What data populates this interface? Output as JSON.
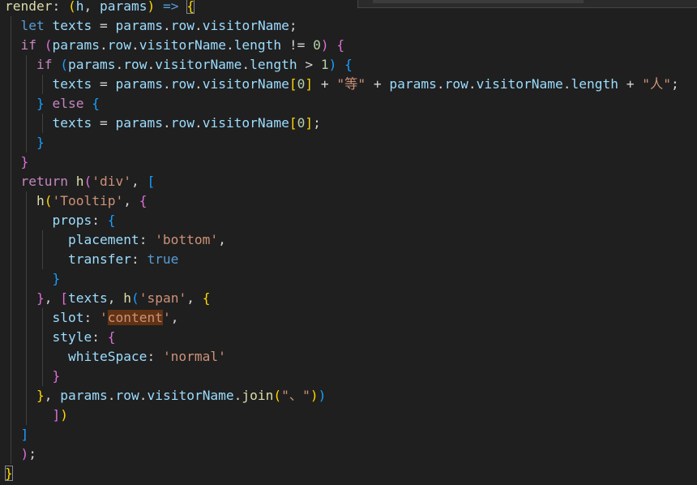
{
  "editor": {
    "lines": [
      [
        {
          "t": "render",
          "c": "fn"
        },
        {
          "t": ": ",
          "c": "plain"
        },
        {
          "t": "(",
          "c": "b1"
        },
        {
          "t": "h",
          "c": "prop"
        },
        {
          "t": ", ",
          "c": "plain"
        },
        {
          "t": "params",
          "c": "prop"
        },
        {
          "t": ")",
          "c": "b1"
        },
        {
          "t": " ",
          "c": "plain"
        },
        {
          "t": "=>",
          "c": "kw-blue"
        },
        {
          "t": " ",
          "c": "plain"
        },
        {
          "t": "{",
          "c": "b1 bracket-match"
        }
      ],
      [
        {
          "t": "  ",
          "c": "plain"
        },
        {
          "t": "let",
          "c": "kw-blue"
        },
        {
          "t": " ",
          "c": "plain"
        },
        {
          "t": "texts",
          "c": "prop"
        },
        {
          "t": " = ",
          "c": "plain"
        },
        {
          "t": "params",
          "c": "prop"
        },
        {
          "t": ".",
          "c": "plain"
        },
        {
          "t": "row",
          "c": "prop"
        },
        {
          "t": ".",
          "c": "plain"
        },
        {
          "t": "visitorName",
          "c": "prop"
        },
        {
          "t": ";",
          "c": "plain"
        }
      ],
      [
        {
          "t": "  ",
          "c": "plain"
        },
        {
          "t": "if",
          "c": "kw-purple"
        },
        {
          "t": " ",
          "c": "plain"
        },
        {
          "t": "(",
          "c": "b2"
        },
        {
          "t": "params",
          "c": "prop"
        },
        {
          "t": ".",
          "c": "plain"
        },
        {
          "t": "row",
          "c": "prop"
        },
        {
          "t": ".",
          "c": "plain"
        },
        {
          "t": "visitorName",
          "c": "prop"
        },
        {
          "t": ".",
          "c": "plain"
        },
        {
          "t": "length",
          "c": "prop"
        },
        {
          "t": " != ",
          "c": "plain"
        },
        {
          "t": "0",
          "c": "num"
        },
        {
          "t": ")",
          "c": "b2"
        },
        {
          "t": " ",
          "c": "plain"
        },
        {
          "t": "{",
          "c": "b2"
        }
      ],
      [
        {
          "t": "    ",
          "c": "plain"
        },
        {
          "t": "if",
          "c": "kw-purple"
        },
        {
          "t": " ",
          "c": "plain"
        },
        {
          "t": "(",
          "c": "b3"
        },
        {
          "t": "params",
          "c": "prop"
        },
        {
          "t": ".",
          "c": "plain"
        },
        {
          "t": "row",
          "c": "prop"
        },
        {
          "t": ".",
          "c": "plain"
        },
        {
          "t": "visitorName",
          "c": "prop"
        },
        {
          "t": ".",
          "c": "plain"
        },
        {
          "t": "length",
          "c": "prop"
        },
        {
          "t": " > ",
          "c": "plain"
        },
        {
          "t": "1",
          "c": "num"
        },
        {
          "t": ")",
          "c": "b3"
        },
        {
          "t": " ",
          "c": "plain"
        },
        {
          "t": "{",
          "c": "b3"
        }
      ],
      [
        {
          "t": "      ",
          "c": "plain"
        },
        {
          "t": "texts",
          "c": "prop"
        },
        {
          "t": " = ",
          "c": "plain"
        },
        {
          "t": "params",
          "c": "prop"
        },
        {
          "t": ".",
          "c": "plain"
        },
        {
          "t": "row",
          "c": "prop"
        },
        {
          "t": ".",
          "c": "plain"
        },
        {
          "t": "visitorName",
          "c": "prop"
        },
        {
          "t": "[",
          "c": "b1"
        },
        {
          "t": "0",
          "c": "num"
        },
        {
          "t": "]",
          "c": "b1"
        },
        {
          "t": " + ",
          "c": "plain"
        },
        {
          "t": "\"等\"",
          "c": "str"
        },
        {
          "t": " + ",
          "c": "plain"
        },
        {
          "t": "params",
          "c": "prop"
        },
        {
          "t": ".",
          "c": "plain"
        },
        {
          "t": "row",
          "c": "prop"
        },
        {
          "t": ".",
          "c": "plain"
        },
        {
          "t": "visitorName",
          "c": "prop"
        },
        {
          "t": ".",
          "c": "plain"
        },
        {
          "t": "length",
          "c": "prop"
        },
        {
          "t": " + ",
          "c": "plain"
        },
        {
          "t": "\"人\"",
          "c": "str"
        },
        {
          "t": ";",
          "c": "plain"
        }
      ],
      [
        {
          "t": "    ",
          "c": "plain"
        },
        {
          "t": "}",
          "c": "b3"
        },
        {
          "t": " ",
          "c": "plain"
        },
        {
          "t": "else",
          "c": "kw-purple"
        },
        {
          "t": " ",
          "c": "plain"
        },
        {
          "t": "{",
          "c": "b3"
        }
      ],
      [
        {
          "t": "      ",
          "c": "plain"
        },
        {
          "t": "texts",
          "c": "prop"
        },
        {
          "t": " = ",
          "c": "plain"
        },
        {
          "t": "params",
          "c": "prop"
        },
        {
          "t": ".",
          "c": "plain"
        },
        {
          "t": "row",
          "c": "prop"
        },
        {
          "t": ".",
          "c": "plain"
        },
        {
          "t": "visitorName",
          "c": "prop"
        },
        {
          "t": "[",
          "c": "b1"
        },
        {
          "t": "0",
          "c": "num"
        },
        {
          "t": "]",
          "c": "b1"
        },
        {
          "t": ";",
          "c": "plain"
        }
      ],
      [
        {
          "t": "    ",
          "c": "plain"
        },
        {
          "t": "}",
          "c": "b3"
        }
      ],
      [
        {
          "t": "  ",
          "c": "plain"
        },
        {
          "t": "}",
          "c": "b2"
        }
      ],
      [
        {
          "t": "  ",
          "c": "plain"
        },
        {
          "t": "return",
          "c": "kw-purple"
        },
        {
          "t": " ",
          "c": "plain"
        },
        {
          "t": "h",
          "c": "fn"
        },
        {
          "t": "(",
          "c": "b2"
        },
        {
          "t": "'div'",
          "c": "str"
        },
        {
          "t": ", ",
          "c": "plain"
        },
        {
          "t": "[",
          "c": "b3"
        }
      ],
      [
        {
          "t": "    ",
          "c": "plain"
        },
        {
          "t": "h",
          "c": "fn"
        },
        {
          "t": "(",
          "c": "b1"
        },
        {
          "t": "'Tooltip'",
          "c": "str"
        },
        {
          "t": ", ",
          "c": "plain"
        },
        {
          "t": "{",
          "c": "b2"
        }
      ],
      [
        {
          "t": "      ",
          "c": "plain"
        },
        {
          "t": "props",
          "c": "prop"
        },
        {
          "t": ": ",
          "c": "plain"
        },
        {
          "t": "{",
          "c": "b3"
        }
      ],
      [
        {
          "t": "        ",
          "c": "plain"
        },
        {
          "t": "placement",
          "c": "prop"
        },
        {
          "t": ": ",
          "c": "plain"
        },
        {
          "t": "'bottom'",
          "c": "str"
        },
        {
          "t": ",",
          "c": "plain"
        }
      ],
      [
        {
          "t": "        ",
          "c": "plain"
        },
        {
          "t": "transfer",
          "c": "prop"
        },
        {
          "t": ": ",
          "c": "plain"
        },
        {
          "t": "true",
          "c": "kw-blue"
        }
      ],
      [
        {
          "t": "      ",
          "c": "plain"
        },
        {
          "t": "}",
          "c": "b3"
        }
      ],
      [
        {
          "t": "    ",
          "c": "plain"
        },
        {
          "t": "}",
          "c": "b2"
        },
        {
          "t": ", ",
          "c": "plain"
        },
        {
          "t": "[",
          "c": "b2"
        },
        {
          "t": "texts",
          "c": "prop"
        },
        {
          "t": ", ",
          "c": "plain"
        },
        {
          "t": "h",
          "c": "fn"
        },
        {
          "t": "(",
          "c": "b3"
        },
        {
          "t": "'span'",
          "c": "str"
        },
        {
          "t": ", ",
          "c": "plain"
        },
        {
          "t": "{",
          "c": "b1"
        }
      ],
      [
        {
          "t": "      ",
          "c": "plain"
        },
        {
          "t": "slot",
          "c": "prop"
        },
        {
          "t": ": ",
          "c": "plain"
        },
        {
          "t": "'",
          "c": "str"
        },
        {
          "t": "content",
          "c": "str hl-word"
        },
        {
          "t": "'",
          "c": "str"
        },
        {
          "t": ",",
          "c": "plain"
        }
      ],
      [
        {
          "t": "      ",
          "c": "plain"
        },
        {
          "t": "style",
          "c": "prop"
        },
        {
          "t": ": ",
          "c": "plain"
        },
        {
          "t": "{",
          "c": "b2"
        }
      ],
      [
        {
          "t": "        ",
          "c": "plain"
        },
        {
          "t": "whiteSpace",
          "c": "prop"
        },
        {
          "t": ": ",
          "c": "plain"
        },
        {
          "t": "'normal'",
          "c": "str"
        }
      ],
      [
        {
          "t": "      ",
          "c": "plain"
        },
        {
          "t": "}",
          "c": "b2"
        }
      ],
      [
        {
          "t": "    ",
          "c": "plain"
        },
        {
          "t": "}",
          "c": "b1"
        },
        {
          "t": ", ",
          "c": "plain"
        },
        {
          "t": "params",
          "c": "prop"
        },
        {
          "t": ".",
          "c": "plain"
        },
        {
          "t": "row",
          "c": "prop"
        },
        {
          "t": ".",
          "c": "plain"
        },
        {
          "t": "visitorName",
          "c": "prop"
        },
        {
          "t": ".",
          "c": "plain"
        },
        {
          "t": "join",
          "c": "fn"
        },
        {
          "t": "(",
          "c": "b1"
        },
        {
          "t": "\"、\"",
          "c": "str"
        },
        {
          "t": ")",
          "c": "b1"
        },
        {
          "t": ")",
          "c": "b3"
        }
      ],
      [
        {
          "t": "      ",
          "c": "plain"
        },
        {
          "t": "]",
          "c": "b2"
        },
        {
          "t": ")",
          "c": "b1"
        }
      ],
      [
        {
          "t": "  ",
          "c": "plain"
        },
        {
          "t": "]",
          "c": "b3"
        }
      ],
      [
        {
          "t": "  ",
          "c": "plain"
        },
        {
          "t": ")",
          "c": "b2"
        },
        {
          "t": ";",
          "c": "plain"
        }
      ],
      [
        {
          "t": "}",
          "c": "b1 bracket-match"
        }
      ]
    ]
  }
}
